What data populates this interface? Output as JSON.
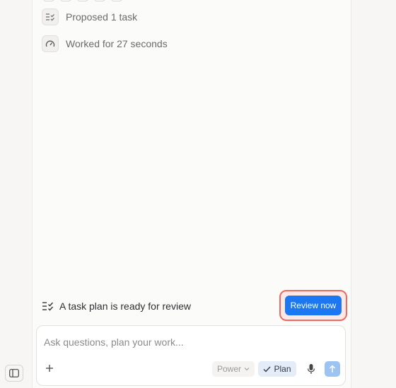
{
  "steps": [
    {
      "label": "Proposed 1 task",
      "icon": "task-list-icon"
    },
    {
      "label": "Worked for 27 seconds",
      "icon": "speedometer-icon"
    }
  ],
  "review": {
    "message": "A task plan is ready for review",
    "button_label": "Review now",
    "icon": "task-list-icon"
  },
  "composer": {
    "placeholder": "Ask questions, plan your work...",
    "value": "",
    "model_label": "Power",
    "plan_label": "Plan"
  },
  "colors": {
    "accent": "#1b78f2",
    "highlight": "#ee6a5e",
    "send_disabled": "#9cc3f2",
    "plan_active_bg": "#e4ecf7"
  }
}
